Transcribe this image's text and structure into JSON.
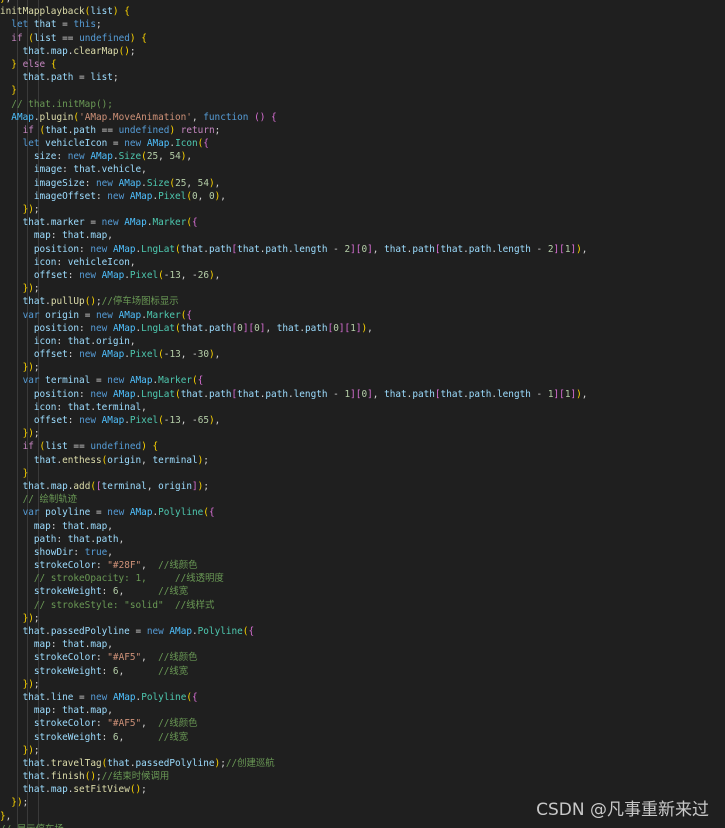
{
  "watermark": "CSDN @凡事重新来过",
  "colors": {
    "background": "#1f1f1f",
    "keyword": "#569cd6",
    "control": "#c586c0",
    "function": "#dcdcaa",
    "variable": "#9cdcfe",
    "string": "#ce9178",
    "number": "#b5cea8",
    "comment": "#6a9955",
    "bracket_1": "#ffd700",
    "bracket_2": "#da70d6",
    "bracket_3": "#179fff"
  },
  "code_lines": [
    "},",
    "initMapplayback(list) {",
    "  let that = this;",
    "  if (list == undefined) {",
    "    that.map.clearMap();",
    "  } else {",
    "    that.path = list;",
    "  }",
    "  // that.initMap();",
    "  AMap.plugin('AMap.MoveAnimation', function () {",
    "    if (that.path == undefined) return;",
    "    let vehicleIcon = new AMap.Icon({",
    "      size: new AMap.Size(25, 54),",
    "      image: that.vehicle,",
    "      imageSize: new AMap.Size(25, 54),",
    "      imageOffset: new AMap.Pixel(0, 0),",
    "    });",
    "    that.marker = new AMap.Marker({",
    "      map: that.map,",
    "      position: new AMap.LngLat(that.path[that.path.length - 2][0], that.path[that.path.length - 2][1]),",
    "      icon: vehicleIcon,",
    "      offset: new AMap.Pixel(-13, -26),",
    "    });",
    "    that.pullUp();//停车场图标显示",
    "    var origin = new AMap.Marker({",
    "      position: new AMap.LngLat(that.path[0][0], that.path[0][1]),",
    "      icon: that.origin,",
    "      offset: new AMap.Pixel(-13, -30),",
    "    });",
    "    var terminal = new AMap.Marker({",
    "      position: new AMap.LngLat(that.path[that.path.length - 1][0], that.path[that.path.length - 1][1]),",
    "      icon: that.terminal,",
    "      offset: new AMap.Pixel(-13, -65),",
    "    });",
    "    if (list == undefined) {",
    "      that.enthess(origin, terminal);",
    "    }",
    "    that.map.add([terminal, origin]);",
    "    // 绘制轨迹",
    "    var polyline = new AMap.Polyline({",
    "      map: that.map,",
    "      path: that.path,",
    "      showDir: true,",
    "      strokeColor: \"#28F\",  //线颜色",
    "      // strokeOpacity: 1,     //线透明度",
    "      strokeWeight: 6,      //线宽",
    "      // strokeStyle: \"solid\"  //线样式",
    "    });",
    "    that.passedPolyline = new AMap.Polyline({",
    "      map: that.map,",
    "      strokeColor: \"#AF5\",  //线颜色",
    "      strokeWeight: 6,      //线宽",
    "    });",
    "    that.line = new AMap.Polyline({",
    "      map: that.map,",
    "      strokeColor: \"#AF5\",  //线颜色",
    "      strokeWeight: 6,      //线宽",
    "    });",
    "    that.travelTag(that.passedPolyline);//创建巡航",
    "    that.finish();//结束时候调用",
    "    that.map.setFitView();",
    "  });",
    "},",
    "// 显示停车场"
  ]
}
